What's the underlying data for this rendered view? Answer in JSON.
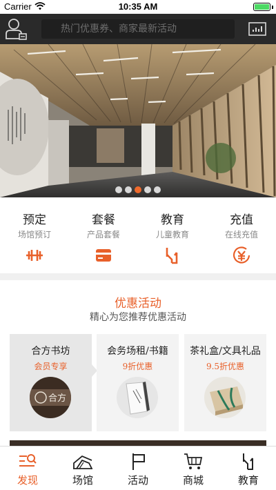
{
  "status_bar": {
    "carrier": "Carrier",
    "time": "10:35 AM",
    "wifi_icon": "wifi-icon",
    "battery_icon": "battery-icon"
  },
  "header": {
    "search_placeholder": "热门优惠券、商家最新活动",
    "left_icon": "user-profile-icon",
    "right_icon": "chart-icon"
  },
  "banner": {
    "slide_count": 5,
    "active_slide": 3
  },
  "quick_nav": [
    {
      "title": "预定",
      "subtitle": "场馆预订",
      "icon": "dumbbell-icon"
    },
    {
      "title": "套餐",
      "subtitle": "产品套餐",
      "icon": "card-icon"
    },
    {
      "title": "教育",
      "subtitle": "儿童教育",
      "icon": "education-icon"
    },
    {
      "title": "充值",
      "subtitle": "在线充值",
      "icon": "yuan-icon"
    }
  ],
  "promo": {
    "title": "优惠活动",
    "subtitle": "精心为您推荐优惠活动",
    "cards": [
      {
        "title": "合方书坊",
        "badge": "会员专享",
        "image_text": "合方"
      },
      {
        "title": "会务场租/书籍",
        "badge": "9折优惠"
      },
      {
        "title": "茶礼盒/文具礼品",
        "badge": "9.5折优惠"
      }
    ]
  },
  "tab_bar": {
    "active": "发现",
    "tabs": [
      {
        "label": "发现",
        "icon": "discover-icon"
      },
      {
        "label": "场馆",
        "icon": "venue-icon"
      },
      {
        "label": "活动",
        "icon": "flag-icon"
      },
      {
        "label": "商城",
        "icon": "cart-icon"
      },
      {
        "label": "教育",
        "icon": "education-icon"
      }
    ]
  },
  "colors": {
    "accent": "#e8602a",
    "header_bg": "#2a2a2a",
    "battery": "#4cd964"
  }
}
